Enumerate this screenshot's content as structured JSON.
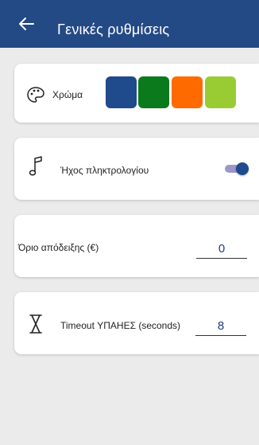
{
  "header": {
    "title": "Γενικές ρυθμίσεις",
    "back_icon": "arrow-left-icon"
  },
  "color_setting": {
    "icon": "palette-icon",
    "label": "Χρώμα",
    "swatches": [
      {
        "name": "blue",
        "color": "#1f4a8c"
      },
      {
        "name": "green",
        "color": "#0b7a1c"
      },
      {
        "name": "orange",
        "color": "#ff6a00"
      },
      {
        "name": "lime",
        "color": "#99cc33"
      }
    ]
  },
  "sound_setting": {
    "icon": "music-note-icon",
    "label": "Ήχος πληκτρολογίου",
    "enabled": true
  },
  "receipt_limit_setting": {
    "label": "Όριο απόδειξης (€)",
    "value": "0"
  },
  "timeout_setting": {
    "icon": "hourglass-icon",
    "label": "Timeout ΥΠΑΗΕΣ (seconds)",
    "value": "8"
  },
  "colors": {
    "appbar": "#244a85",
    "background": "#ebebeb",
    "card": "#ffffff",
    "toggle_thumb": "#1f4a8c",
    "toggle_track": "#9b98c9"
  }
}
